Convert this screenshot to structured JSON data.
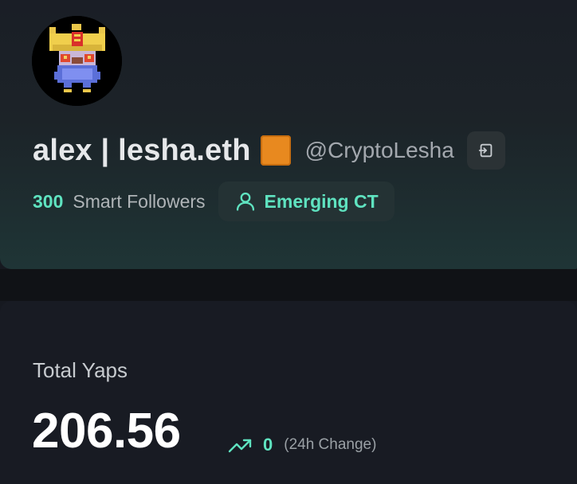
{
  "profile": {
    "display_name": "alex | lesha.eth",
    "handle": "@CryptoLesha",
    "avatar_icon": "pixel-crowned-avatar",
    "name_emoji_icon": "orange-square-emoji",
    "login_icon": "login-arrow-icon",
    "smart_followers_count": "300",
    "smart_followers_label": "Smart Followers",
    "tier_icon": "user-icon",
    "tier_label": "Emerging CT"
  },
  "yaps": {
    "title": "Total Yaps",
    "total": "206.56",
    "change_icon": "trending-up-icon",
    "change_value": "0",
    "change_label": "(24h Change)"
  },
  "colors": {
    "accent": "#5fe3c0",
    "background": "#161920",
    "emoji_orange": "#e8891f"
  }
}
